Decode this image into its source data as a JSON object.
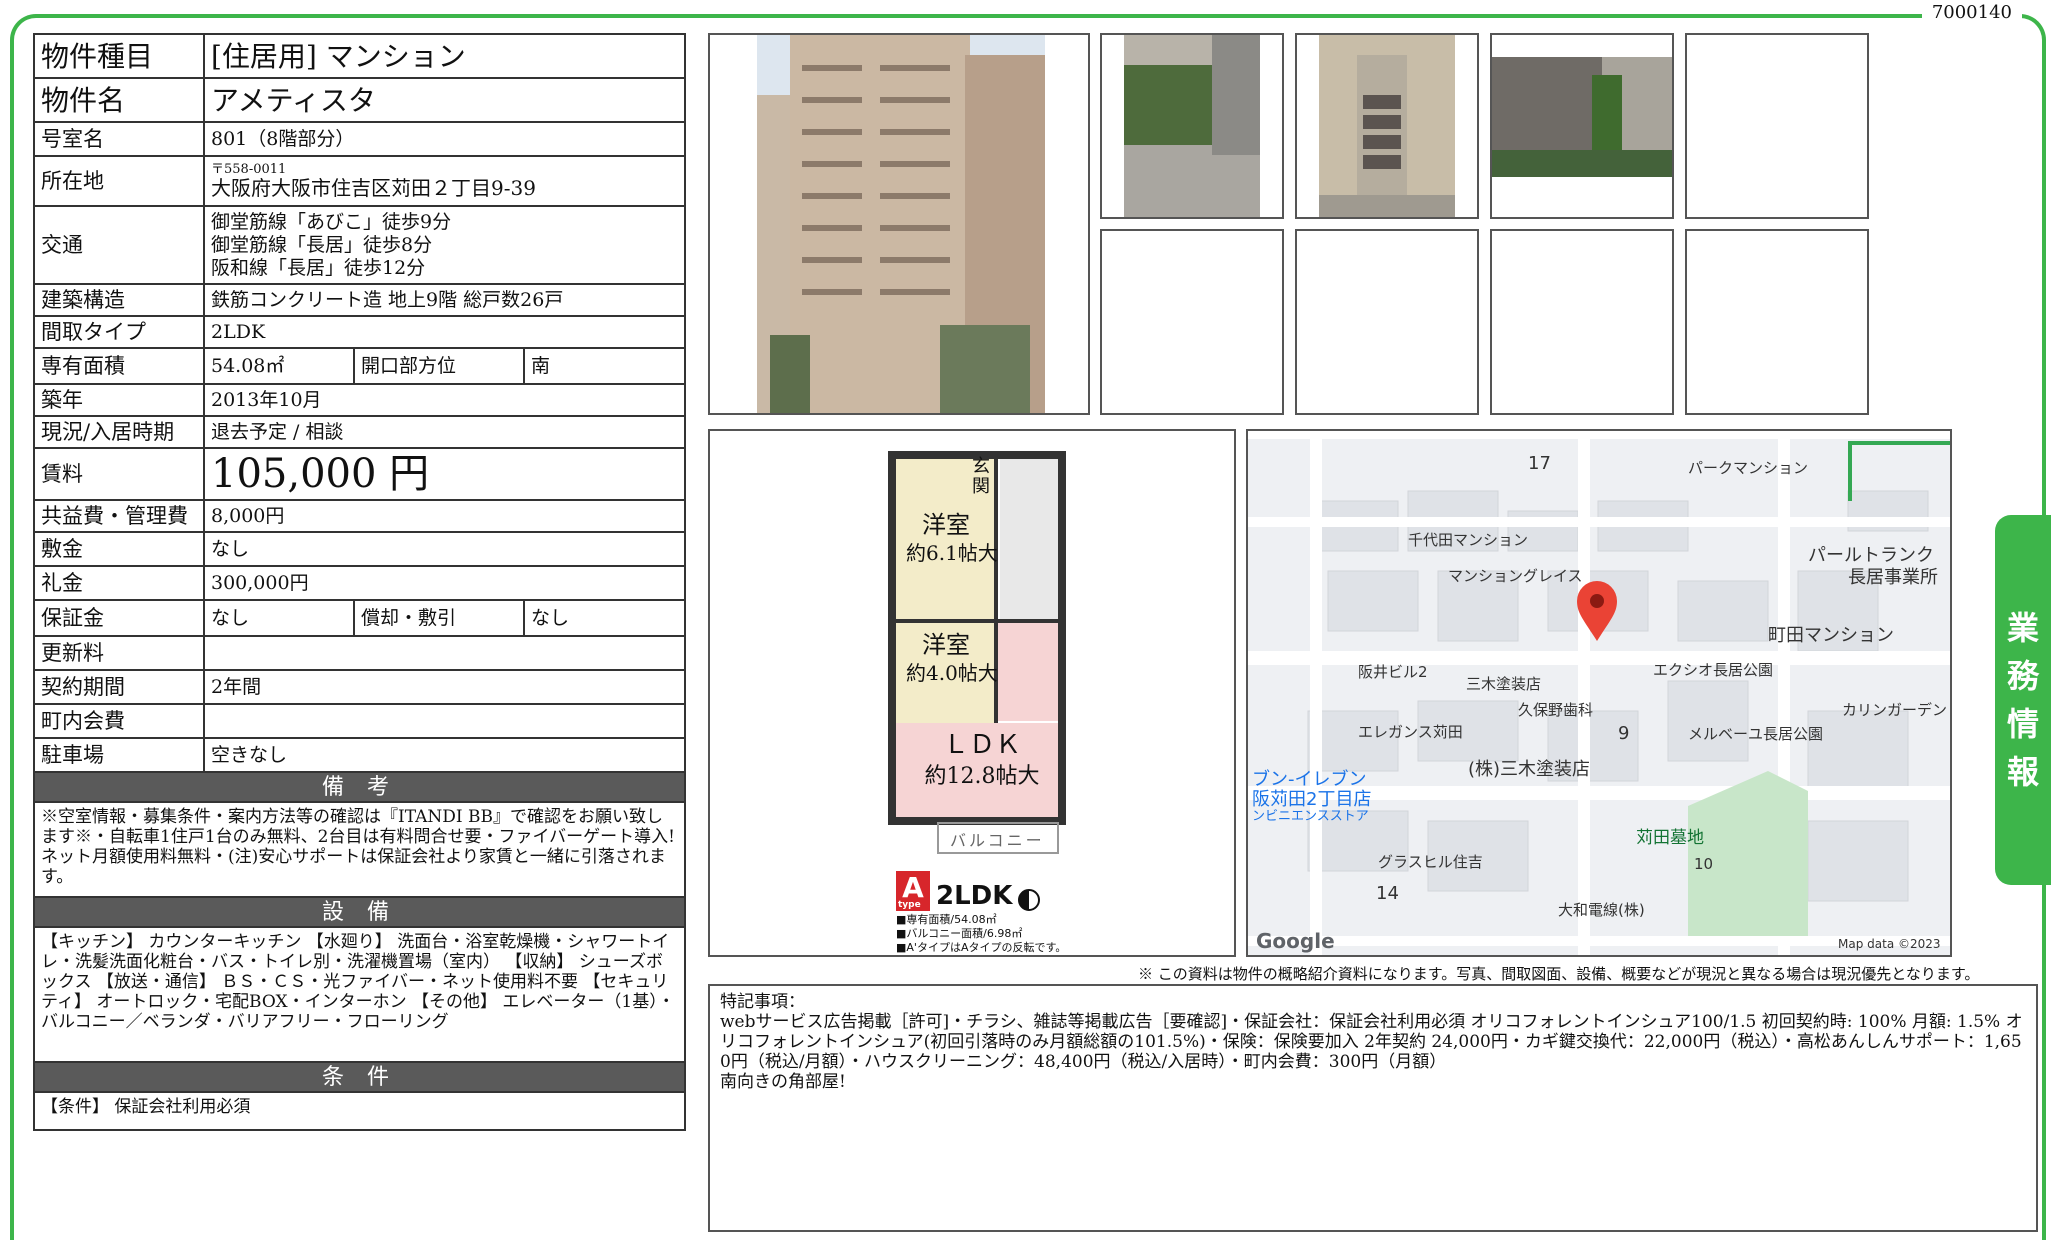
{
  "doc_id": "7000140",
  "side_tab": [
    "業",
    "務",
    "情",
    "報"
  ],
  "spec": {
    "type_label": "物件種目",
    "type_value": "[住居用] マンション",
    "name_label": "物件名",
    "name_value": "アメティスタ",
    "room_label": "号室名",
    "room_value": "801（8階部分）",
    "addr_label": "所在地",
    "addr_zip": "〒558-0011",
    "addr_value": "大阪府大阪市住吉区苅田２丁目9-39",
    "access_label": "交通",
    "access": [
      "御堂筋線「あびこ」徒歩9分",
      "御堂筋線「長居」徒歩8分",
      "阪和線「長居」徒歩12分"
    ],
    "structure_label": "建築構造",
    "structure_value": "鉄筋コンクリート造 地上9階 総戸数26戸",
    "layout_label": "間取タイプ",
    "layout_value": "2LDK",
    "area_label": "専有面積",
    "area_value": "54.08㎡",
    "dir_label": "開口部方位",
    "dir_value": "南",
    "built_label": "築年",
    "built_value": "2013年10月",
    "status_label": "現況/入居時期",
    "status_value": "退去予定 / 相談",
    "rent_label": "賃料",
    "rent_value": "105,000 円",
    "fee_label": "共益費・管理費",
    "fee_value": "8,000円",
    "deposit_label": "敷金",
    "deposit_value": "なし",
    "key_label": "礼金",
    "key_value": "300,000円",
    "guarantee_label": "保証金",
    "guarantee_value": "なし",
    "amort_label": "償却・敷引",
    "amort_value": "なし",
    "renew_label": "更新料",
    "renew_value": "",
    "contract_label": "契約期間",
    "contract_value": "2年間",
    "town_label": "町内会費",
    "town_value": "",
    "parking_label": "駐車場",
    "parking_value": "空きなし"
  },
  "remarks_title": "備 考",
  "remarks": "※空室情報・募集条件・案内方法等の確認は『ITANDI BB』で確認をお願い致します※・自転車1住戸1台のみ無料、2台目は有料問合せ要・ファイバーゲート導入!ネット月額使用料無料・(注)安心サポートは保証会社より家賃と一緒に引落されます。",
  "equip_title": "設 備",
  "equip": "【キッチン】 カウンターキッチン 【水廻り】 洗面台・浴室乾燥機・シャワートイレ・洗髪洗面化粧台・バス・トイレ別・洗濯機置場（室内） 【収納】 シューズボックス 【放送・通信】 ＢＳ・ＣＳ・光ファイバー・ネット使用料不要 【セキュリティ】 オートロック・宅配BOX・インターホン 【その他】 エレベーター（1基）・バルコニー／ベランダ・バリアフリー・フローリング",
  "cond_title": "条 件",
  "cond": "【条件】 保証会社利用必須",
  "floorplan": {
    "rooms": [
      "洋室",
      "約6.1帖大",
      "洋室",
      "約4.0帖大",
      "ＬＤＫ",
      "約12.8帖大",
      "玄関",
      "バルコニー"
    ],
    "badge": "A",
    "badge_sub": "type",
    "type": "2LDK",
    "specs": [
      "■専有面積/54.08㎡",
      "■バルコニー面積/6.98㎡",
      "■A'タイプはAタイプの反転です。"
    ]
  },
  "map": {
    "labels": [
      "17",
      "パークマンション",
      "千代田マンション",
      "パールトランク",
      "長居事業所",
      "マンショングレイス",
      "町田マンション",
      "阪井ビル2",
      "三木塗装店",
      "エクシオ長居公園",
      "カリンガーデン",
      "久保野歯科",
      "9",
      "メルベーユ長居公園",
      "エレガンス苅田",
      "(株)三木塗装店",
      "ブン-イレブン",
      "阪苅田2丁目店",
      "ンビニエンスストア",
      "苅田墓地",
      "10",
      "グラスヒル住吉",
      "14",
      "大和電線(株)",
      "Google",
      "Map data ©2023"
    ]
  },
  "disclaimer": "※ この資料は物件の概略紹介資料になります。写真、間取図面、設備、概要などが現況と異なる場合は現況優先となります。",
  "notes": {
    "title": "特記事項：",
    "body": "webサービス広告掲載［許可]・チラシ、雑誌等掲載広告［要確認]・保証会社：保証会社利用必須 オリコフォレントインシュア100/1.5 初回契約時: 100% 月額: 1.5% オリコフォレントインシュア(初回引落時のみ月額総額の101.5%)・保険：保険要加入 2年契約 24,000円・カギ鍵交換代：22,000円（税込）・高松あんしんサポート：1,650円（税込/月額）・ハウスクリーニング：48,400円（税込/入居時）・町内会費：300円（月額）",
    "extra": "南向きの角部屋!"
  }
}
